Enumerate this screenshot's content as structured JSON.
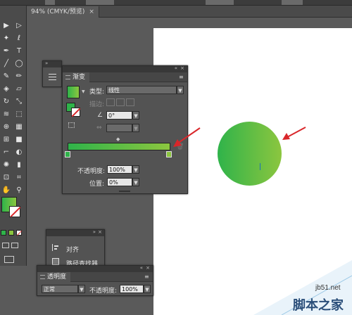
{
  "document_tab": {
    "title": "94% (CMYK/预览)",
    "close": "×"
  },
  "gradient_panel": {
    "tab_label": "渐变",
    "type_label": "类型:",
    "type_value": "线性",
    "stroke_label": "描边:",
    "angle_value": "0°",
    "aspect_value": "",
    "opacity_label": "不透明度:",
    "opacity_value": "100%",
    "position_label": "位置:",
    "position_value": "0%",
    "gradient_start": "#2fb34a",
    "gradient_end": "#8cc63f"
  },
  "align_panel": {
    "items": [
      {
        "label": "对齐"
      },
      {
        "label": "路径查找器"
      }
    ]
  },
  "transparency_panel": {
    "tab_label": "透明度",
    "blend_mode": "正常",
    "opacity_label": "不透明度:",
    "opacity_value": "100%"
  },
  "watermark": {
    "site": "jb51.net",
    "name": "脚本之家"
  },
  "colors": {
    "arrow": "#d9262a",
    "panel": "#535353",
    "background": "#5a5a5a"
  }
}
